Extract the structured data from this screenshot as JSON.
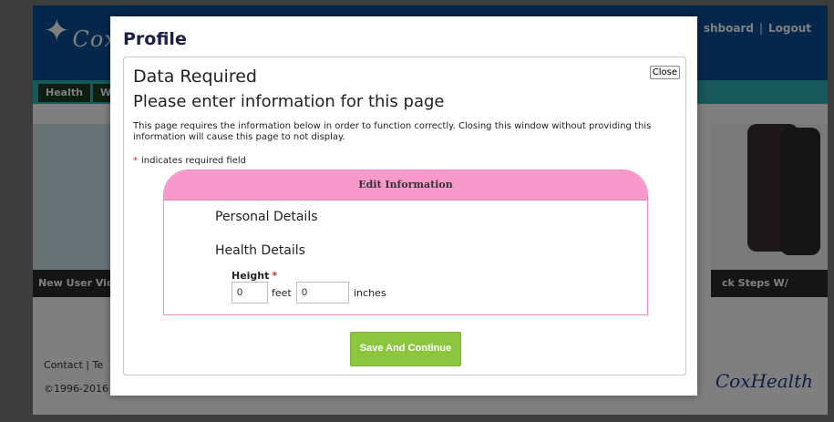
{
  "site": {
    "logo_text": "Cox",
    "header_links": [
      "Dashboard",
      "Logout"
    ],
    "header_links_visible": "shboard",
    "nav": {
      "health": "Health",
      "next": "W"
    },
    "promo_left_caption": "New User Vid",
    "promo_right_caption": "ck Steps W/",
    "footer_links": "Contact | Te",
    "copyright": "©1996-2016",
    "footer_logo": "CoxHealth"
  },
  "modal": {
    "title": "Profile",
    "panel_heading": "Data Required",
    "close_label": "Close",
    "subheading": "Please enter information for this page",
    "message": "This page requires the information below in order to function correctly. Closing this window without providing this information will cause this page to not display.",
    "required_note": "indicates required field",
    "required_symbol": "*",
    "form": {
      "header": "Edit Information",
      "section_personal": "Personal Details",
      "section_health": "Health Details",
      "height_label": "Height",
      "feet_value": "0",
      "feet_unit": "feet",
      "inches_value": "0",
      "inches_unit": "inches"
    },
    "submit_label": "Save And Continue"
  },
  "colors": {
    "brand_blue": "#0d4f99",
    "teal": "#2fb2b5",
    "pink_header": "#f79acb",
    "pink_border": "#f08bc3",
    "green_button": "#8cc63f",
    "required_red": "#d9232d"
  }
}
